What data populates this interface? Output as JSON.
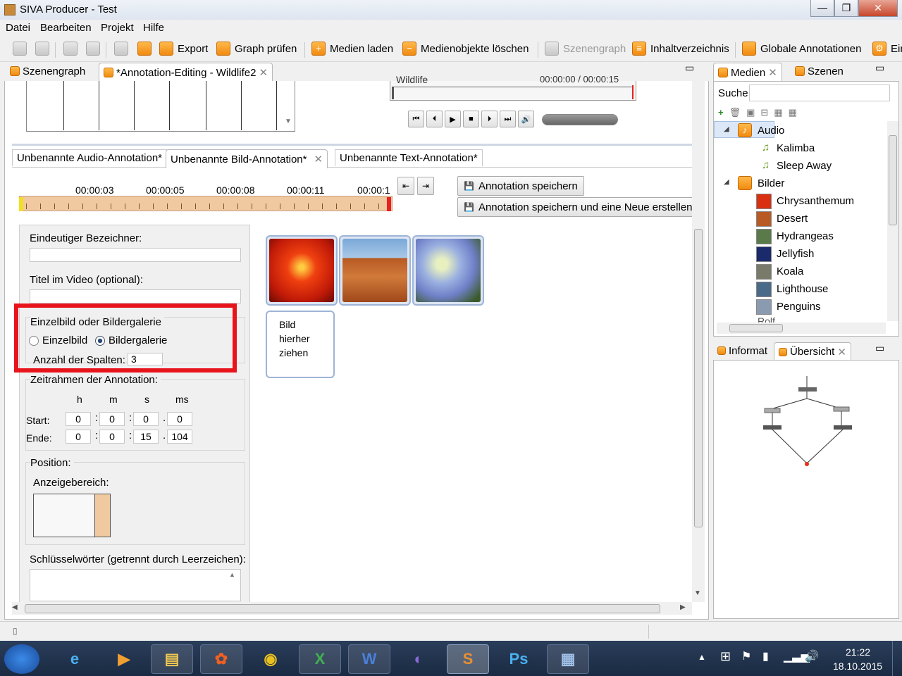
{
  "window": {
    "title": "SIVA Producer - Test",
    "min": "—",
    "max": "❐",
    "close": "✕"
  },
  "menu": [
    "Datei",
    "Bearbeiten",
    "Projekt",
    "Hilfe"
  ],
  "toolbar": {
    "export": "Export",
    "graph": "Graph prüfen",
    "medien_laden": "Medien laden",
    "loeschen": "Medienobjekte löschen",
    "szenengraph": "Szenengraph",
    "inhalt": "Inhaltverzeichnis",
    "global": "Globale Annotationen",
    "ein": "Ein"
  },
  "editor_tabs": {
    "t1": "Szenengraph",
    "t2": "*Annotation-Editing - Wildlife2"
  },
  "player": {
    "track_label": "Wildlife",
    "time": "00:00:00 / 00:00:15"
  },
  "anno_tabs": {
    "t1": "Unbenannte Audio-Annotation*",
    "t2": "Unbenannte Bild-Annotation*",
    "t3": "Unbenannte Text-Annotation*"
  },
  "timeline": {
    "ticks": [
      "00:00:03",
      "00:00:05",
      "00:00:08",
      "00:00:11",
      "00:00:1"
    ]
  },
  "buttons": {
    "save": "Annotation speichern",
    "save_new": "Annotation speichern und eine Neue erstellen"
  },
  "form": {
    "bezeichner": "Eindeutiger Bezeichner:",
    "titel": "Titel im Video (optional):",
    "gallery_group": "Einzelbild oder Bildergalerie",
    "einzelbild": "Einzelbild",
    "bildergalerie": "Bildergalerie",
    "spalten_label": "Anzahl der Spalten:",
    "spalten_value": "3",
    "zeitrahmen": "Zeitrahmen der Annotation:",
    "h": "h",
    "m": "m",
    "s": "s",
    "ms": "ms",
    "start": "Start:",
    "ende": "Ende:",
    "start_vals": [
      "0",
      "0",
      "0",
      "0"
    ],
    "ende_vals": [
      "0",
      "0",
      "15",
      "104"
    ],
    "position": "Position:",
    "anzeige": "Anzeigebereich:",
    "keywords": "Schlüsselwörter (getrennt durch Leerzeichen):"
  },
  "dropzone": {
    "text1": "Bild",
    "text2": "hierher",
    "text3": "ziehen"
  },
  "media": {
    "tab1": "Medien",
    "tab2": "Szenen",
    "search_label": "Suche",
    "audio": "Audio",
    "audio_items": [
      "Kalimba",
      "Sleep Away"
    ],
    "bilder": "Bilder",
    "bilder_items": [
      "Chrysanthemum",
      "Desert",
      "Hydrangeas",
      "Jellyfish",
      "Koala",
      "Lighthouse",
      "Penguins"
    ],
    "partial": "Rolf"
  },
  "overview": {
    "tab1": "Informat",
    "tab2": "Übersicht"
  },
  "clock": {
    "time": "21:22",
    "date": "18.10.2015"
  },
  "colors": {
    "accent": "#f08a10",
    "highlight": "#e8141c",
    "selection": "#dce8f8"
  }
}
